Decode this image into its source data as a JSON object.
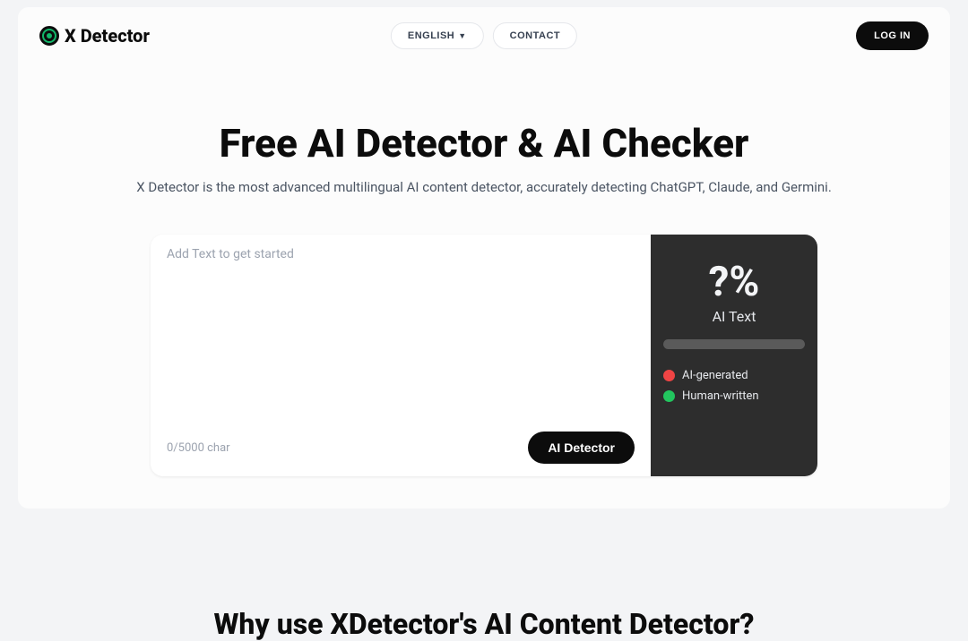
{
  "nav": {
    "logo_text": "X Detector",
    "language_label": "ENGLISH",
    "contact_label": "CONTACT",
    "login_label": "LOG IN"
  },
  "hero": {
    "title": "Free AI Detector & AI Checker",
    "subtitle": "X Detector is the most advanced multilingual AI content detector, accurately detecting ChatGPT, Claude, and Germini."
  },
  "detector": {
    "placeholder": "Add Text to get started",
    "char_count": "0/5000 char",
    "button_label": "AI Detector"
  },
  "result": {
    "percent": "?%",
    "percent_label": "AI Text",
    "legend_ai": "AI-generated",
    "legend_human": "Human-written"
  },
  "section2": {
    "title": "Why use XDetector's AI Content Detector?"
  }
}
